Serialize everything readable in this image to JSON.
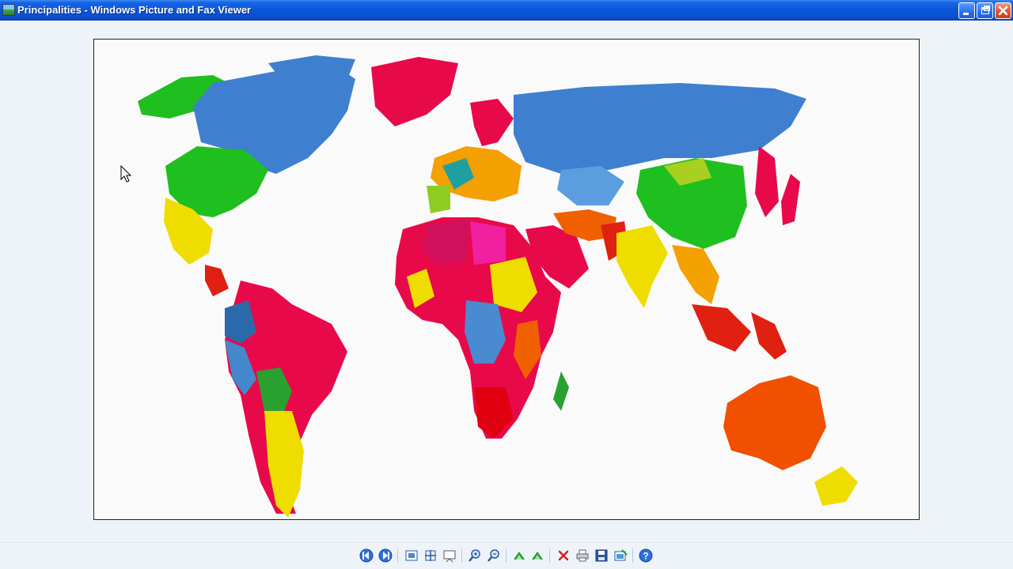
{
  "window": {
    "title": "Principalities - Windows Picture and Fax Viewer"
  },
  "icons": {
    "app": "picture-viewer-icon",
    "minimize": "minimize-icon",
    "maximize": "restore-icon",
    "close": "close-icon"
  },
  "image": {
    "subject": "world-political-map"
  },
  "toolbar": {
    "buttons": [
      "previous-image-icon",
      "next-image-icon",
      "best-fit-icon",
      "actual-size-icon",
      "slideshow-icon",
      "zoom-in-icon",
      "zoom-out-icon",
      "rotate-clockwise-icon",
      "rotate-counterclockwise-icon",
      "delete-icon",
      "print-icon",
      "save-icon",
      "edit-icon",
      "help-icon"
    ]
  },
  "colors": {
    "title_bar": "#0a56d8",
    "viewer_bg": "#eef3fa",
    "close_button": "#e05a35"
  }
}
